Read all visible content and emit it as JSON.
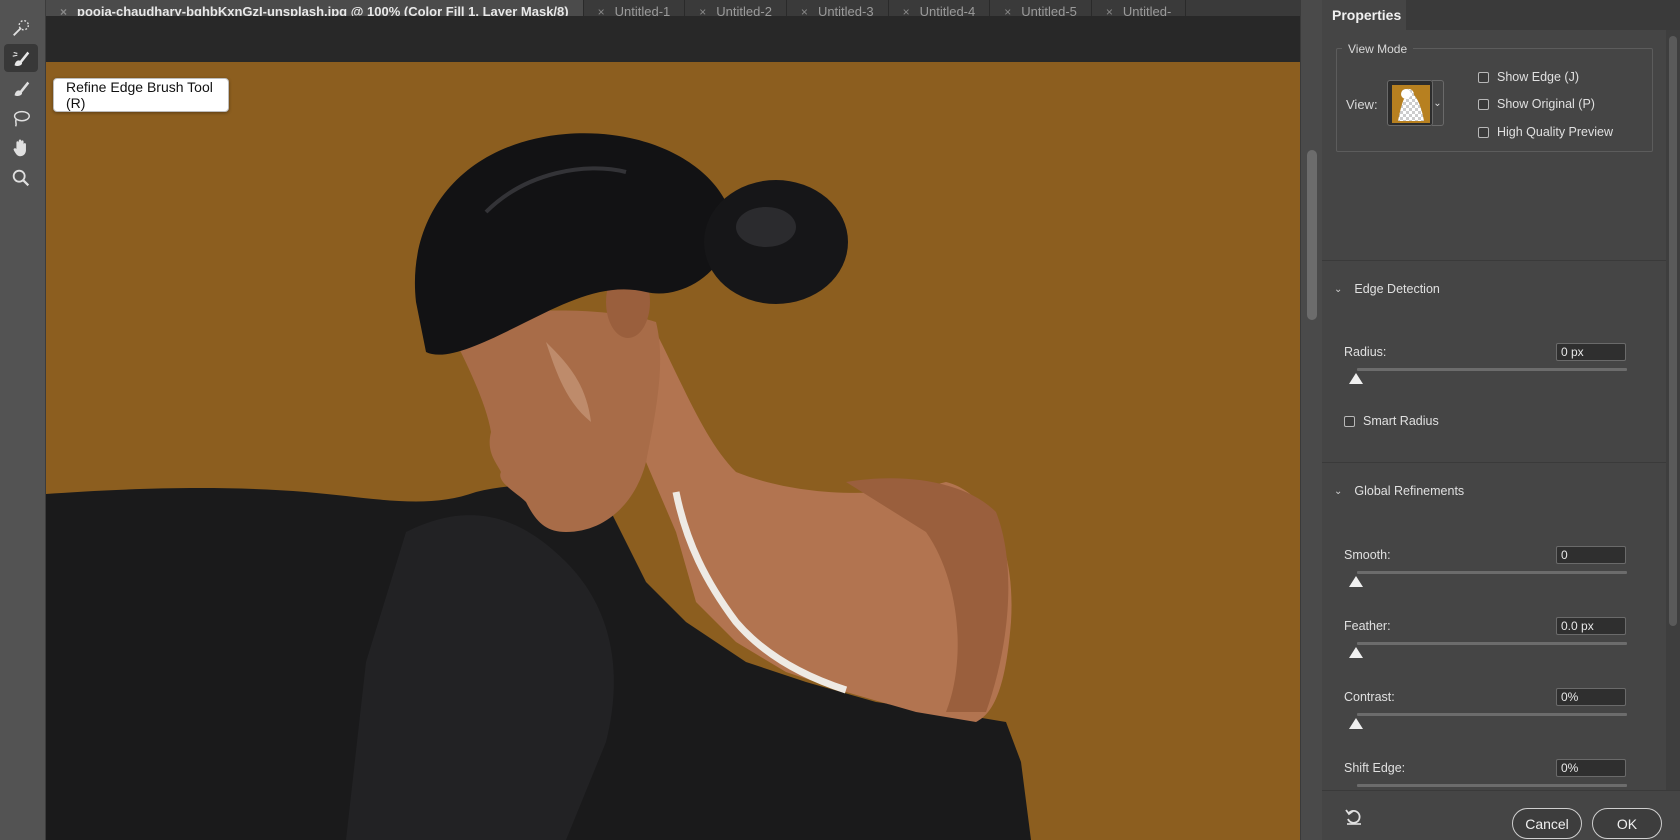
{
  "tabs": [
    {
      "label": "pooja-chaudhary-bqhbKxnGzI-unsplash.jpg @ 100% (Color Fill 1, Layer Mask/8)",
      "active": true
    },
    {
      "label": "Untitled-1",
      "active": false
    },
    {
      "label": "Untitled-2",
      "active": false
    },
    {
      "label": "Untitled-3",
      "active": false
    },
    {
      "label": "Untitled-4",
      "active": false
    },
    {
      "label": "Untitled-5",
      "active": false
    },
    {
      "label": "Untitled-",
      "active": false
    }
  ],
  "toolbar": {
    "tools": [
      {
        "name": "quick-selection-tool",
        "icon": "quick-selection-icon",
        "active": false
      },
      {
        "name": "refine-edge-brush-tool",
        "icon": "refine-edge-brush-icon",
        "active": true
      },
      {
        "name": "brush-tool",
        "icon": "brush-icon",
        "active": false
      },
      {
        "name": "lasso-tool",
        "icon": "lasso-icon",
        "active": false
      },
      {
        "name": "hand-tool",
        "icon": "hand-icon",
        "active": false
      },
      {
        "name": "zoom-tool",
        "icon": "zoom-icon",
        "active": false
      }
    ],
    "tooltip": "Refine Edge Brush Tool (R)"
  },
  "canvas": {
    "background_color": "#8c5e1f"
  },
  "properties": {
    "tab_label": "Properties",
    "view_mode": {
      "legend": "View Mode",
      "view_label": "View:",
      "options": [
        {
          "label": "Show Edge (J)",
          "checked": false
        },
        {
          "label": "Show Original (P)",
          "checked": false
        },
        {
          "label": "High Quality Preview",
          "checked": false
        }
      ]
    },
    "edge_detection": {
      "title": "Edge Detection",
      "radius_label": "Radius:",
      "radius_value": "0 px",
      "smart_radius_label": "Smart Radius",
      "smart_radius_checked": false
    },
    "global_refinements": {
      "title": "Global Refinements",
      "smooth_label": "Smooth:",
      "smooth_value": "0",
      "feather_label": "Feather:",
      "feather_value": "0.0 px",
      "contrast_label": "Contrast:",
      "contrast_value": "0%",
      "shift_edge_label": "Shift Edge:",
      "shift_edge_value": "0%"
    },
    "footer": {
      "cancel_label": "Cancel",
      "ok_label": "OK"
    }
  }
}
